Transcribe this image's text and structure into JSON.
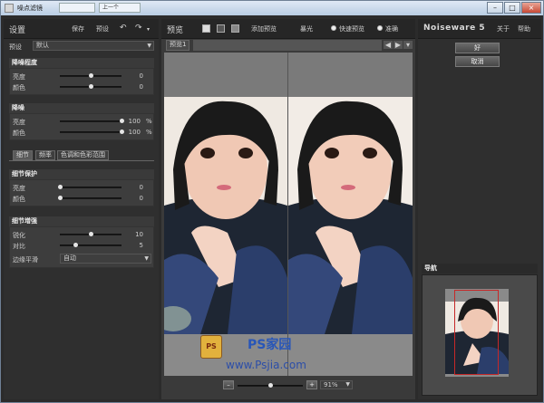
{
  "window": {
    "title": "噪点滤镜",
    "tab2": "上一个",
    "min": "–",
    "max": "□",
    "close": "×"
  },
  "left": {
    "title": "设置",
    "save": "保存",
    "preset_btn": "预设",
    "preset_label": "预设",
    "preset_value": "默认",
    "section_level": {
      "title": "降噪程度",
      "rows": [
        {
          "label": "亮度",
          "value": "0",
          "level": 0.5
        },
        {
          "label": "颜色",
          "value": "0",
          "level": 0.5
        }
      ]
    },
    "section_nr": {
      "title": "降噪",
      "rows": [
        {
          "label": "亮度",
          "value": "100",
          "unit": "%",
          "level": 1.0
        },
        {
          "label": "颜色",
          "value": "100",
          "unit": "%",
          "level": 1.0
        }
      ]
    },
    "tabs": [
      "细节",
      "频率",
      "色调和色彩范围"
    ],
    "section_detail": {
      "title": "细节保护",
      "rows": [
        {
          "label": "亮度",
          "value": "0",
          "level": 0.0
        },
        {
          "label": "颜色",
          "value": "0",
          "level": 0.0
        }
      ]
    },
    "section_enh": {
      "title": "细节增强",
      "rows": [
        {
          "label": "锐化",
          "value": "10",
          "level": 0.5
        },
        {
          "label": "对比",
          "value": "5",
          "level": 0.25
        }
      ],
      "edge_label": "边缘平滑",
      "edge_value": "自动"
    }
  },
  "mid": {
    "title": "预览",
    "add": "添加预览",
    "exposure": "暴光",
    "fast": "快速预览",
    "accurate": "准确",
    "tab": "预览1",
    "zoom_minus": "–",
    "zoom_plus": "+",
    "zoom": "91%",
    "zoom_level": 0.5,
    "watermark": "www.Psjia.com",
    "watermark_brand": "PS家园",
    "watermark_badge": "PS"
  },
  "right": {
    "brand": "Noiseware 5",
    "about": "关于",
    "help": "帮助",
    "ok": "好",
    "cancel": "取消",
    "nav": "导航"
  },
  "colors": {
    "panel": "#2f2f2f",
    "accent": "#c62828"
  }
}
